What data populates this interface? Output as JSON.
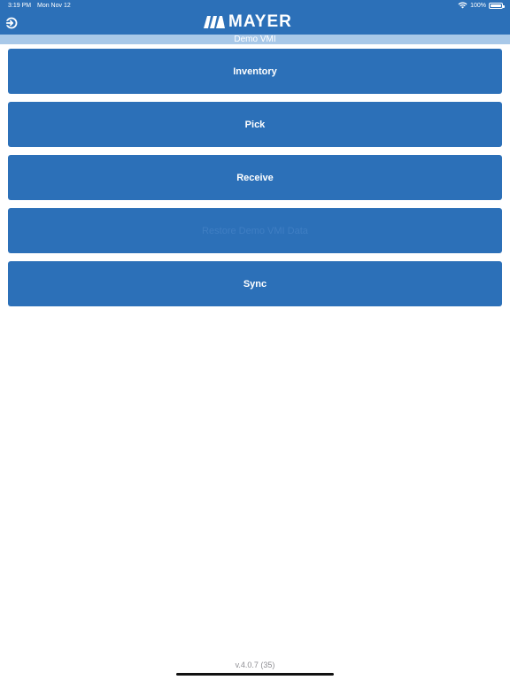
{
  "status_bar": {
    "time": "3:19 PM",
    "date": "Mon Nov 12",
    "battery": "100%"
  },
  "header": {
    "brand": "MAYER",
    "subtitle": "Demo VMI"
  },
  "menu": {
    "items": [
      {
        "label": "Inventory",
        "enabled": true
      },
      {
        "label": "Pick",
        "enabled": true
      },
      {
        "label": "Receive",
        "enabled": true
      },
      {
        "label": "Restore Demo VMI Data",
        "enabled": false
      },
      {
        "label": "Sync",
        "enabled": true
      }
    ]
  },
  "footer": {
    "version": "v.4.0.7 (35)"
  },
  "colors": {
    "primary": "#2c70b8",
    "subheader": "#a8c8e8",
    "background": "#ffffff"
  }
}
